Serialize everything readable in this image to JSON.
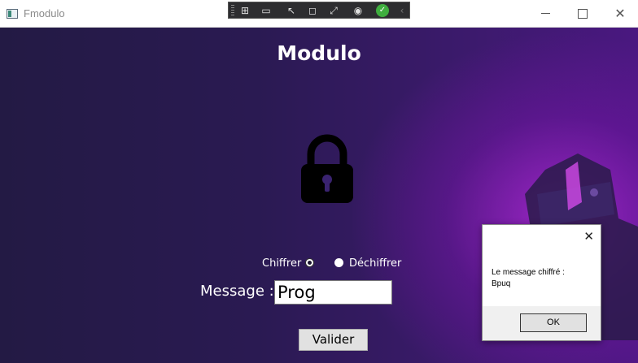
{
  "window": {
    "title": "Fmodulo",
    "controls": {
      "minimize_icon": "minimize-icon",
      "maximize_icon": "maximize-icon",
      "close_icon": "close-icon"
    }
  },
  "debug_toolbar": {
    "icons": [
      "grip-icon",
      "select-element-icon",
      "record-icon",
      "pointer-icon",
      "frame-icon",
      "hot-reload-icon",
      "live-icon",
      "check-icon",
      "collapse-chevron-icon"
    ]
  },
  "form": {
    "heading": "Modulo",
    "lock_icon": "lock-icon",
    "radio_chiffrer": {
      "label": "Chiffrer",
      "checked": true
    },
    "radio_dechiffrer": {
      "label": "Déchiffrer",
      "checked": false
    },
    "message_label": "Message :",
    "message_value": "Prog",
    "submit_label": "Valider"
  },
  "message_box": {
    "line1": "Le message chiffré :",
    "line2": "Bpuq",
    "ok_label": "OK"
  },
  "colors": {
    "background_dark": "#231a44",
    "background_glow": "#aa28d2",
    "heading_text": "#ffffff"
  }
}
